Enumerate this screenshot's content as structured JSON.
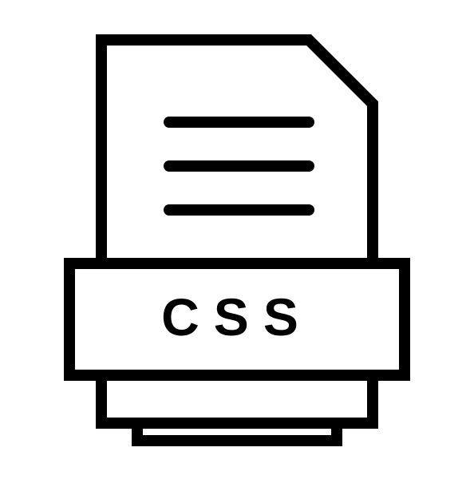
{
  "icon": {
    "label": "CSS",
    "semantic_name": "css-file-icon",
    "stroke_color": "#000000",
    "fill_color": "#ffffff"
  }
}
